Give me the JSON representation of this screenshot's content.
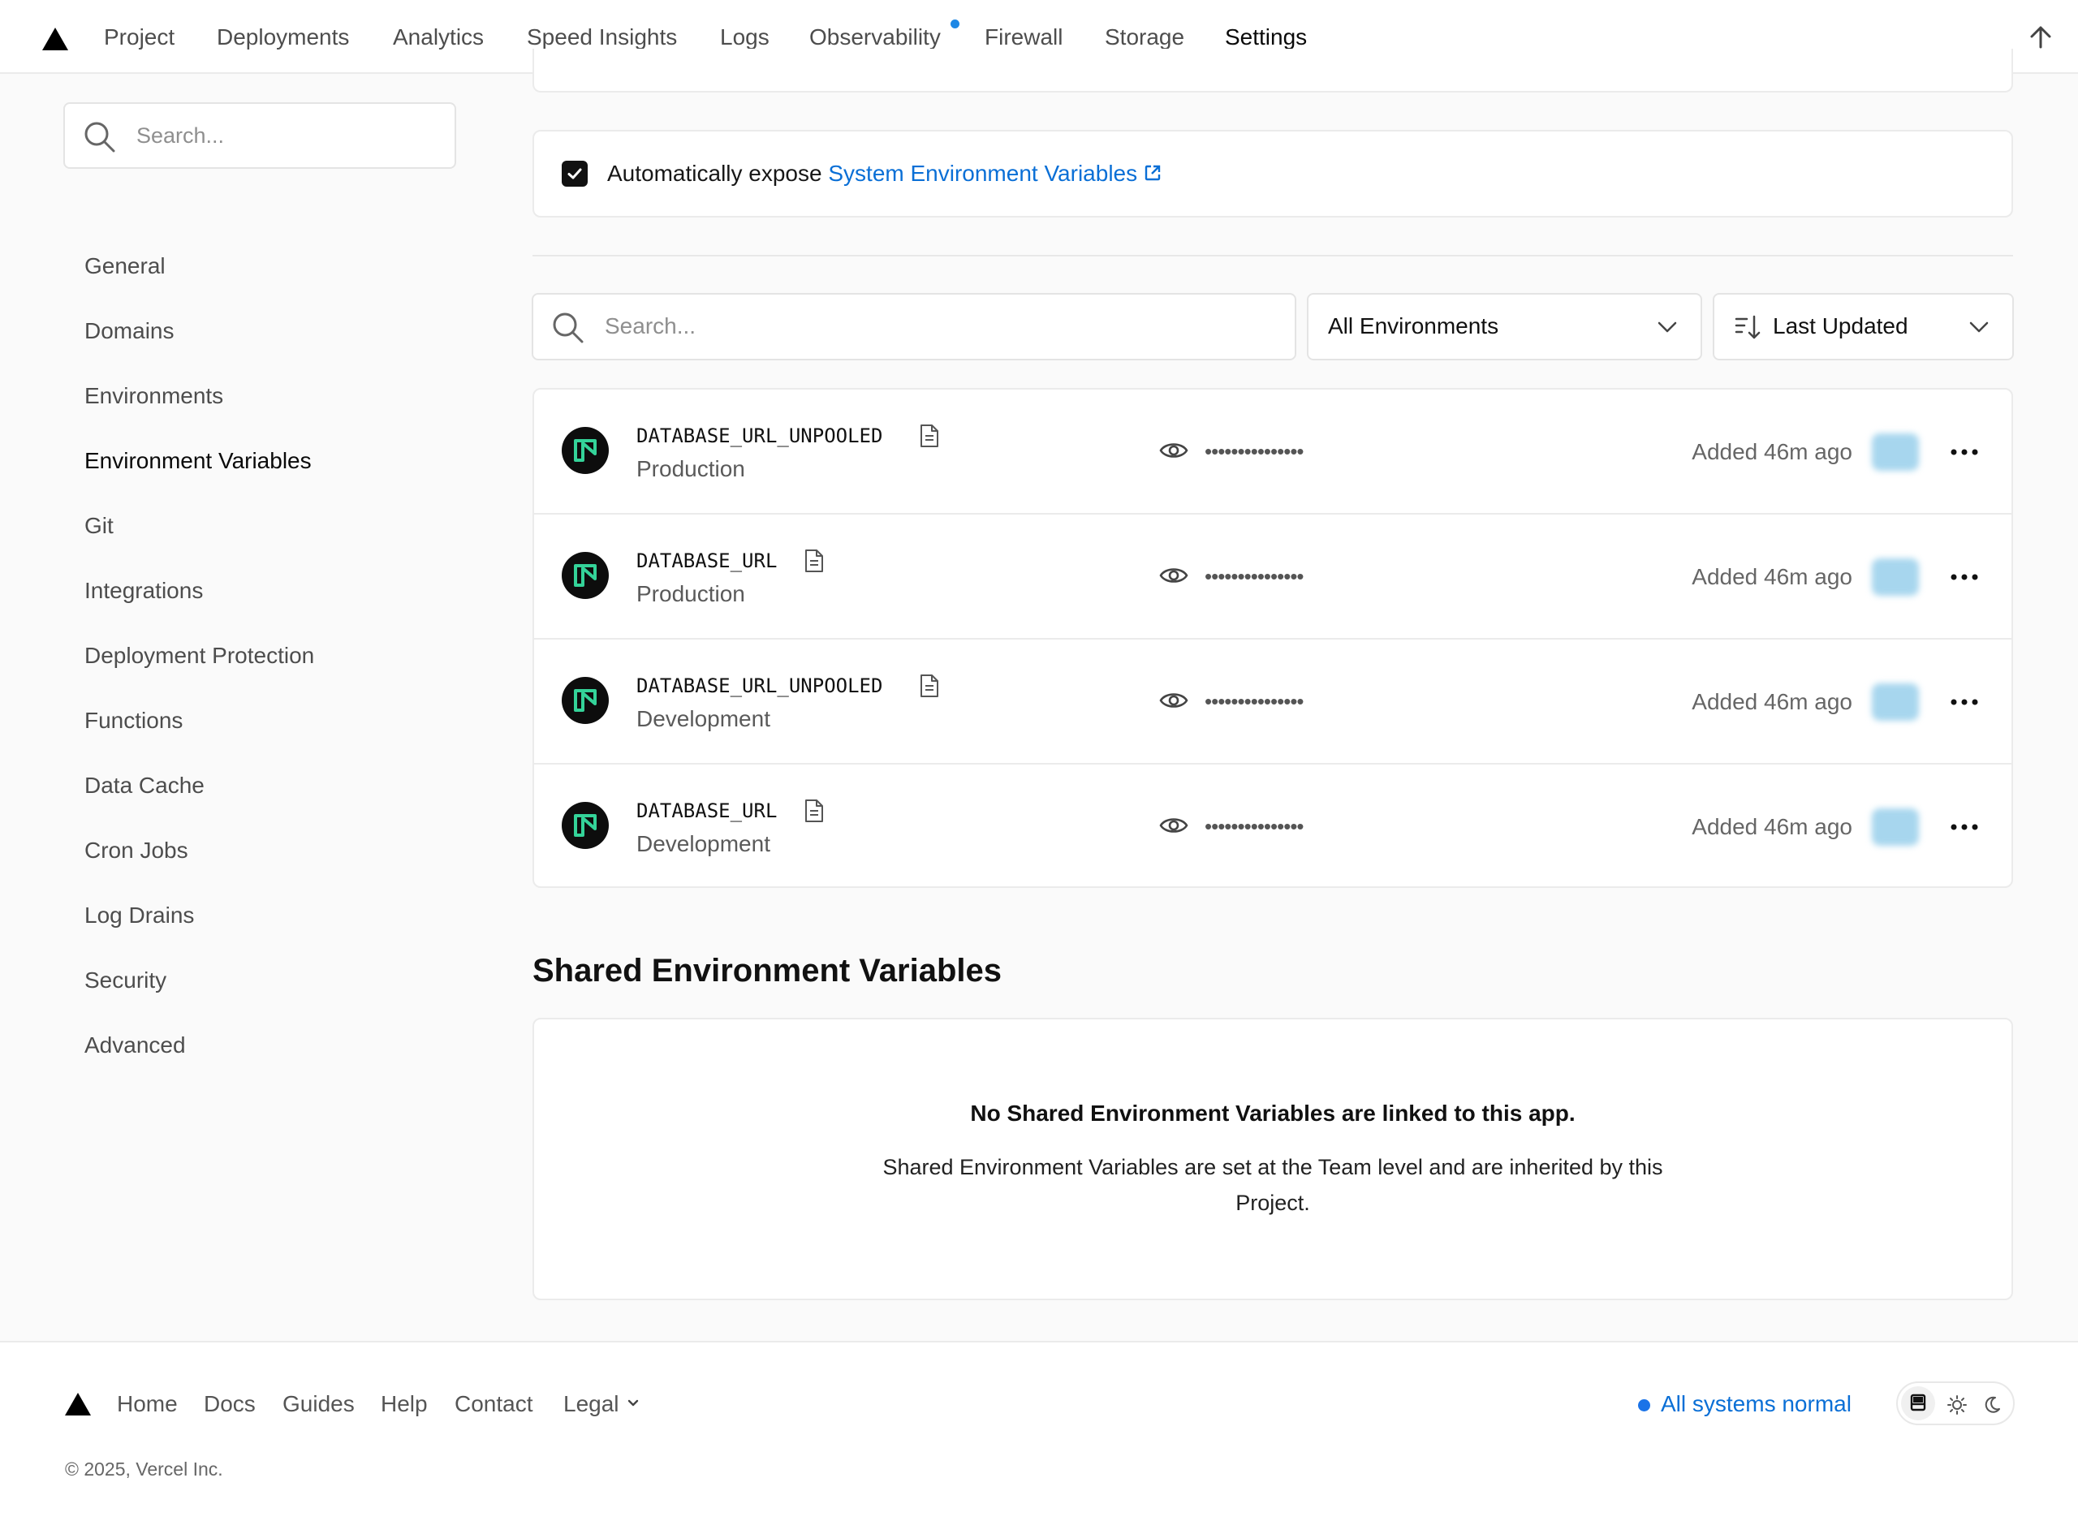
{
  "nav": {
    "tabs": [
      "Project",
      "Deployments",
      "Analytics",
      "Speed Insights",
      "Logs",
      "Observability",
      "Firewall",
      "Storage",
      "Settings"
    ],
    "active": "Settings"
  },
  "sidebar": {
    "search_placeholder": "Search...",
    "items": [
      "General",
      "Domains",
      "Environments",
      "Environment Variables",
      "Git",
      "Integrations",
      "Deployment Protection",
      "Functions",
      "Data Cache",
      "Cron Jobs",
      "Log Drains",
      "Security",
      "Advanced"
    ],
    "active": "Environment Variables"
  },
  "expose": {
    "checked": true,
    "text": "Automatically expose",
    "link": "System Environment Variables"
  },
  "filters": {
    "search_placeholder": "Search...",
    "environment": "All Environments",
    "sort": "Last Updated"
  },
  "variables": [
    {
      "name": "DATABASE_URL_UNPOOLED",
      "env": "Production",
      "value": "•••••••••••••••",
      "added": "Added 46m ago"
    },
    {
      "name": "DATABASE_URL",
      "env": "Production",
      "value": "•••••••••••••••",
      "added": "Added 46m ago"
    },
    {
      "name": "DATABASE_URL_UNPOOLED",
      "env": "Development",
      "value": "•••••••••••••••",
      "added": "Added 46m ago"
    },
    {
      "name": "DATABASE_URL",
      "env": "Development",
      "value": "•••••••••••••••",
      "added": "Added 46m ago"
    }
  ],
  "shared": {
    "heading": "Shared Environment Variables",
    "empty_title": "No Shared Environment Variables are linked to this app.",
    "empty_desc": "Shared Environment Variables are set at the Team level and are inherited by this Project."
  },
  "footer": {
    "links": [
      "Home",
      "Docs",
      "Guides",
      "Help",
      "Contact",
      "Legal"
    ],
    "status": "All systems normal",
    "copyright": "© 2025, Vercel Inc."
  },
  "colors": {
    "accent": "#0a6fd6",
    "neon_green": "#34d399",
    "status_dot": "#1a73e8"
  }
}
